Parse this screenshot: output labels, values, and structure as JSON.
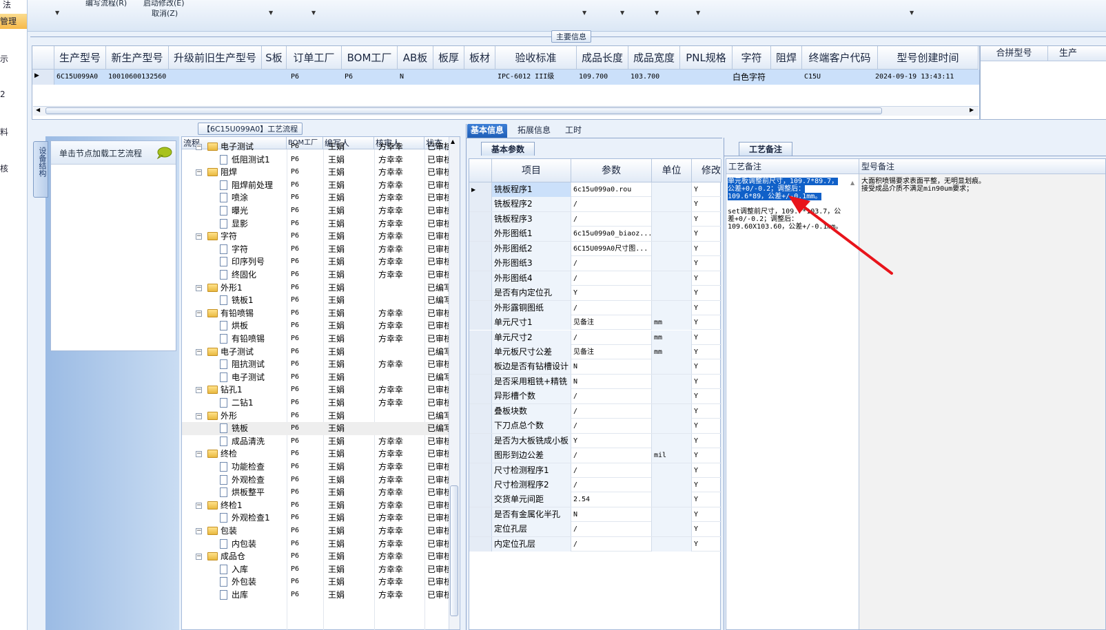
{
  "ribbon": {
    "items": [
      {
        "label": "编写流程(R)"
      },
      {
        "label": "启动修改(E)"
      },
      {
        "label": "取消(Z)"
      }
    ]
  },
  "left_nav": {
    "items": [
      {
        "label": "法"
      },
      {
        "label": "管理"
      },
      {
        "label": "示"
      },
      {
        "label": "2"
      },
      {
        "label": "料"
      },
      {
        "label": "核"
      }
    ]
  },
  "main_info": {
    "section_title": "主要信息",
    "columns": [
      "生产型号",
      "新生产型号",
      "升级前旧生产型号",
      "S板",
      "订单工厂",
      "BOM工厂",
      "AB板",
      "板厚",
      "板材",
      "验收标准",
      "成品长度",
      "成品宽度",
      "PNL规格",
      "字符",
      "阻焊",
      "终端客户代码",
      "型号创建时间"
    ],
    "right_columns": [
      "合拼型号",
      "生产"
    ],
    "row": {
      "model": "6C15U099A0",
      "new_model": "10010600132560",
      "order_factory": "P6",
      "bom_factory": "P6",
      "ab_board": "N",
      "standard": "IPC-6012 III级",
      "length": "109.700",
      "width": "103.700",
      "char": "白色字符",
      "customer_code": "C15U",
      "created": "2024-09-19 13:43:11"
    }
  },
  "flow": {
    "panel_title": "【6C15U099A0】工艺流程",
    "side_tab": "设备结构",
    "load_hint": "单击节点加载工艺流程",
    "columns": [
      "流程",
      "BOM工厂",
      "编写人",
      "核审人",
      "状态"
    ],
    "rows": [
      {
        "name": "电子测试",
        "level": 0,
        "bom": "P6",
        "editor": "王娟",
        "reviewer": "方幸幸",
        "status": "已审核"
      },
      {
        "name": "低阻测试1",
        "level": 1,
        "bom": "P6",
        "editor": "王娟",
        "reviewer": "方幸幸",
        "status": "已审核"
      },
      {
        "name": "阻焊",
        "level": 0,
        "bom": "P6",
        "editor": "王娟",
        "reviewer": "方幸幸",
        "status": "已审核"
      },
      {
        "name": "阻焊前处理",
        "level": 1,
        "bom": "P6",
        "editor": "王娟",
        "reviewer": "方幸幸",
        "status": "已审核"
      },
      {
        "name": "喷涂",
        "level": 1,
        "bom": "P6",
        "editor": "王娟",
        "reviewer": "方幸幸",
        "status": "已审核"
      },
      {
        "name": "曝光",
        "level": 1,
        "bom": "P6",
        "editor": "王娟",
        "reviewer": "方幸幸",
        "status": "已审核"
      },
      {
        "name": "显影",
        "level": 1,
        "bom": "P6",
        "editor": "王娟",
        "reviewer": "方幸幸",
        "status": "已审核"
      },
      {
        "name": "字符",
        "level": 0,
        "bom": "P6",
        "editor": "王娟",
        "reviewer": "方幸幸",
        "status": "已审核"
      },
      {
        "name": "字符",
        "level": 1,
        "bom": "P6",
        "editor": "王娟",
        "reviewer": "方幸幸",
        "status": "已审核"
      },
      {
        "name": "印序列号",
        "level": 1,
        "bom": "P6",
        "editor": "王娟",
        "reviewer": "方幸幸",
        "status": "已审核"
      },
      {
        "name": "终固化",
        "level": 1,
        "bom": "P6",
        "editor": "王娟",
        "reviewer": "方幸幸",
        "status": "已审核"
      },
      {
        "name": "外形1",
        "level": 0,
        "bom": "P6",
        "editor": "王娟",
        "reviewer": "",
        "status": "已编写"
      },
      {
        "name": "铣板1",
        "level": 1,
        "bom": "P6",
        "editor": "王娟",
        "reviewer": "",
        "status": "已编写"
      },
      {
        "name": "有铅喷锡",
        "level": 0,
        "bom": "P6",
        "editor": "王娟",
        "reviewer": "方幸幸",
        "status": "已审核"
      },
      {
        "name": "烘板",
        "level": 1,
        "bom": "P6",
        "editor": "王娟",
        "reviewer": "方幸幸",
        "status": "已审核"
      },
      {
        "name": "有铅喷锡",
        "level": 1,
        "bom": "P6",
        "editor": "王娟",
        "reviewer": "方幸幸",
        "status": "已审核"
      },
      {
        "name": "电子测试",
        "level": 0,
        "bom": "P6",
        "editor": "王娟",
        "reviewer": "",
        "status": "已编写"
      },
      {
        "name": "阻抗测试",
        "level": 1,
        "bom": "P6",
        "editor": "王娟",
        "reviewer": "方幸幸",
        "status": "已审核"
      },
      {
        "name": "电子测试",
        "level": 1,
        "bom": "P6",
        "editor": "王娟",
        "reviewer": "",
        "status": "已编写"
      },
      {
        "name": "钻孔1",
        "level": 0,
        "bom": "P6",
        "editor": "王娟",
        "reviewer": "方幸幸",
        "status": "已审核"
      },
      {
        "name": "二钻1",
        "level": 1,
        "bom": "P6",
        "editor": "王娟",
        "reviewer": "方幸幸",
        "status": "已审核"
      },
      {
        "name": "外形",
        "level": 0,
        "bom": "P6",
        "editor": "王娟",
        "reviewer": "",
        "status": "已编写"
      },
      {
        "name": "铣板",
        "level": 1,
        "bom": "P6",
        "editor": "王娟",
        "reviewer": "",
        "status": "已编写",
        "selected": true
      },
      {
        "name": "成品清洗",
        "level": 1,
        "bom": "P6",
        "editor": "王娟",
        "reviewer": "方幸幸",
        "status": "已审核"
      },
      {
        "name": "终检",
        "level": 0,
        "bom": "P6",
        "editor": "王娟",
        "reviewer": "方幸幸",
        "status": "已审核"
      },
      {
        "name": "功能检查",
        "level": 1,
        "bom": "P6",
        "editor": "王娟",
        "reviewer": "方幸幸",
        "status": "已审核"
      },
      {
        "name": "外观检查",
        "level": 1,
        "bom": "P6",
        "editor": "王娟",
        "reviewer": "方幸幸",
        "status": "已审核"
      },
      {
        "name": "烘板整平",
        "level": 1,
        "bom": "P6",
        "editor": "王娟",
        "reviewer": "方幸幸",
        "status": "已审核"
      },
      {
        "name": "终检1",
        "level": 0,
        "bom": "P6",
        "editor": "王娟",
        "reviewer": "方幸幸",
        "status": "已审核"
      },
      {
        "name": "外观检查1",
        "level": 1,
        "bom": "P6",
        "editor": "王娟",
        "reviewer": "方幸幸",
        "status": "已审核"
      },
      {
        "name": "包装",
        "level": 0,
        "bom": "P6",
        "editor": "王娟",
        "reviewer": "方幸幸",
        "status": "已审核"
      },
      {
        "name": "内包装",
        "level": 1,
        "bom": "P6",
        "editor": "王娟",
        "reviewer": "方幸幸",
        "status": "已审核"
      },
      {
        "name": "成品仓",
        "level": 0,
        "bom": "P6",
        "editor": "王娟",
        "reviewer": "方幸幸",
        "status": "已审核"
      },
      {
        "name": "入库",
        "level": 1,
        "bom": "P6",
        "editor": "王娟",
        "reviewer": "方幸幸",
        "status": "已审核"
      },
      {
        "name": "外包装",
        "level": 1,
        "bom": "P6",
        "editor": "王娟",
        "reviewer": "方幸幸",
        "status": "已审核"
      },
      {
        "name": "出库",
        "level": 1,
        "bom": "P6",
        "editor": "王娟",
        "reviewer": "方幸幸",
        "status": "已审核"
      }
    ]
  },
  "basic": {
    "tabs": [
      "基本信息",
      "拓展信息",
      "工时"
    ],
    "subtab": "基本参数",
    "columns": [
      "项目",
      "参数",
      "单位",
      "修改"
    ],
    "rows": [
      {
        "item": "铣板程序1",
        "param": "6c15u099a0.rou",
        "unit": "",
        "mod": "Y",
        "selected": true
      },
      {
        "item": "铣板程序2",
        "param": "/",
        "unit": "",
        "mod": "Y"
      },
      {
        "item": "铣板程序3",
        "param": "/",
        "unit": "",
        "mod": "Y"
      },
      {
        "item": "外形图纸1",
        "param": "6c15u099a0_biaoz...",
        "unit": "",
        "mod": "Y"
      },
      {
        "item": "外形图纸2",
        "param": "6C15U099A0尺寸图...",
        "unit": "",
        "mod": "Y"
      },
      {
        "item": "外形图纸3",
        "param": "/",
        "unit": "",
        "mod": "Y"
      },
      {
        "item": "外形图纸4",
        "param": "/",
        "unit": "",
        "mod": "Y"
      },
      {
        "item": "是否有内定位孔",
        "param": "Y",
        "unit": "",
        "mod": "Y"
      },
      {
        "item": "外形露铜图纸",
        "param": "/",
        "unit": "",
        "mod": "Y"
      },
      {
        "item": "单元尺寸1",
        "param": "见备注",
        "unit": "mm",
        "mod": "Y"
      },
      {
        "item": "单元尺寸2",
        "param": "/",
        "unit": "mm",
        "mod": "Y"
      },
      {
        "item": "单元板尺寸公差",
        "param": "见备注",
        "unit": "mm",
        "mod": "Y"
      },
      {
        "item": "板边是否有钻槽设计",
        "param": "N",
        "unit": "",
        "mod": "Y"
      },
      {
        "item": "是否采用粗铣+精铣",
        "param": "N",
        "unit": "",
        "mod": "Y"
      },
      {
        "item": "异形槽个数",
        "param": "/",
        "unit": "",
        "mod": "Y"
      },
      {
        "item": "叠板块数",
        "param": "/",
        "unit": "",
        "mod": "Y"
      },
      {
        "item": "下刀点总个数",
        "param": "/",
        "unit": "",
        "mod": "Y"
      },
      {
        "item": "是否为大板铣成小板",
        "param": "Y",
        "unit": "",
        "mod": "Y"
      },
      {
        "item": "图形到边公差",
        "param": "/",
        "unit": "mil",
        "mod": "Y"
      },
      {
        "item": "尺寸检测程序1",
        "param": "/",
        "unit": "",
        "mod": "Y"
      },
      {
        "item": "尺寸检测程序2",
        "param": "/",
        "unit": "",
        "mod": "Y"
      },
      {
        "item": "交货单元间距",
        "param": "2.54",
        "unit": "",
        "mod": "Y"
      },
      {
        "item": "是否有金属化半孔",
        "param": "N",
        "unit": "",
        "mod": "Y"
      },
      {
        "item": "定位孔层",
        "param": "/",
        "unit": "",
        "mod": "Y"
      },
      {
        "item": "内定位孔层",
        "param": "/",
        "unit": "",
        "mod": "Y"
      }
    ]
  },
  "notes": {
    "tab": "工艺备注",
    "process_header": "工艺备注",
    "model_header": "型号备注",
    "process_highlight": "单元板调整前尺寸，109.7*89.7，公差+0/-0.2；调整后：109.6*89，公差+/-0.1mm。",
    "process_rest": "set调整前尺寸，109.7*103.7，公差+0/-0.2；调整后：109.60X103.60，公差+/-0.1mm。",
    "model_note": "大面积喷锡要求表面平整，无明显划痕。\n接受成品介质不满足min90um要求；"
  },
  "colors": {
    "selection": "#cbe0fa",
    "highlight": "#1060c8",
    "arrow": "#e8141b",
    "active_tab": "#1f5fb8"
  }
}
